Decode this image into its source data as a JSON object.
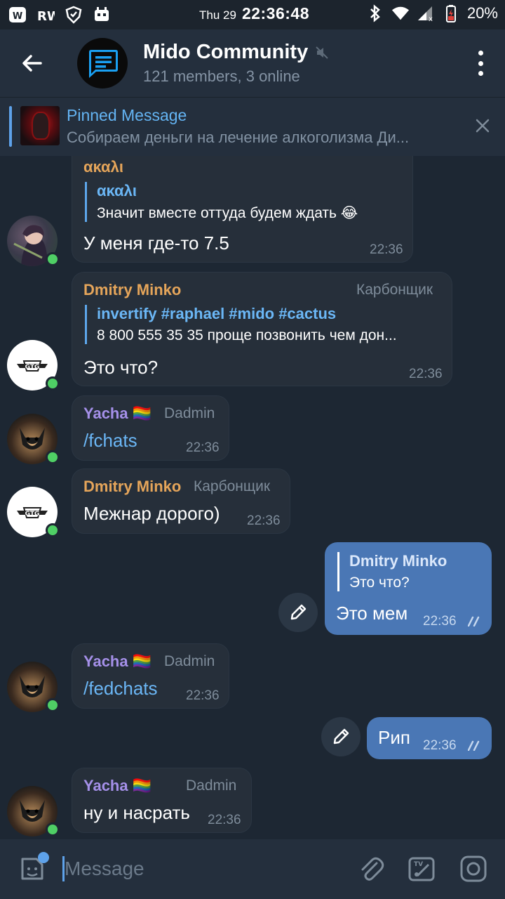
{
  "status_bar": {
    "day": "Thu 29",
    "time": "22:36:48",
    "battery": "20%"
  },
  "header": {
    "title": "Mido Community",
    "subtitle": "121 members, 3 online"
  },
  "pinned": {
    "title": "Pinned Message",
    "text": "Собираем деньги на лечение алкоголизма Ди..."
  },
  "messages": [
    {
      "sender": "ακαλι",
      "reply_name": "ακαλι",
      "reply_text": "Значит вместе оттуда будем ждать 😂",
      "text": "У меня где-то 7.5",
      "time": "22:36"
    },
    {
      "sender": "Dmitry Minko",
      "rank": "Карбонщик",
      "reply_name": "invertify #raphael #mido #cactus",
      "reply_text": "8 800 555 35 35 проще позвонить чем дон...",
      "text": "Это что?",
      "time": "22:36"
    },
    {
      "sender": "Yacha 🏳️‍🌈",
      "rank": "Dadmin",
      "text": "/fchats",
      "time": "22:36"
    },
    {
      "sender": "Dmitry Minko",
      "rank": "Карбонщик",
      "text": "Межнар дорого)",
      "time": "22:36"
    },
    {
      "reply_name": "Dmitry Minko",
      "reply_text": "Это что?",
      "text": "Это мем",
      "time": "22:36"
    },
    {
      "sender": "Yacha 🏳️‍🌈",
      "rank": "Dadmin",
      "text": "/fedchats",
      "time": "22:36"
    },
    {
      "text": "Рип",
      "time": "22:36"
    },
    {
      "sender": "Yacha 🏳️‍🌈",
      "rank": "Dadmin",
      "text": "ну и насрать",
      "time": "22:36"
    }
  ],
  "composer": {
    "placeholder": "Message"
  },
  "icons": {
    "back": "arrow-left-icon",
    "mute": "muted-speaker-icon",
    "menu": "more-vertical-icon",
    "close": "close-icon",
    "edit": "pencil-icon",
    "emoji": "sticker-emoji-icon",
    "attach": "paperclip-icon",
    "bot": "bot-commands-icon",
    "camera": "instagram-camera-icon"
  },
  "colors": {
    "background": "#1d2733",
    "header": "#242f3d",
    "incoming_bubble": "#262f3a",
    "outgoing_bubble": "#4a77b5",
    "accent": "#5ea2ea",
    "online": "#4fcf65"
  }
}
